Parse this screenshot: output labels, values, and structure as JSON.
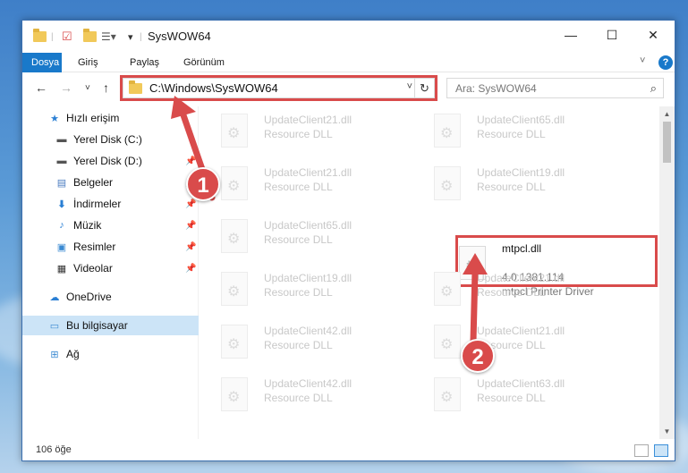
{
  "window": {
    "title": "SysWOW64",
    "controls": {
      "minimize": "—",
      "maximize": "☐",
      "close": "✕"
    }
  },
  "ribbon": {
    "tabs": [
      {
        "label": "Dosya",
        "active": true
      },
      {
        "label": "Giriş",
        "active": false
      },
      {
        "label": "Paylaş",
        "active": false
      },
      {
        "label": "Görünüm",
        "active": false
      }
    ],
    "help": "?"
  },
  "nav": {
    "back": "←",
    "forward": "→",
    "recent": "˅",
    "up": "↑",
    "address": "C:\\Windows\\SysWOW64",
    "search_placeholder": "Ara: SysWOW64"
  },
  "sidebar": {
    "items": [
      {
        "label": "Hızlı erişim",
        "icon": "star-icon",
        "pinned": false,
        "selected": false
      },
      {
        "label": "Yerel Disk (C:)",
        "icon": "drive-icon",
        "pinned": false,
        "selected": false
      },
      {
        "label": "Yerel Disk (D:)",
        "icon": "drive-icon",
        "pinned": true,
        "selected": false
      },
      {
        "label": "Belgeler",
        "icon": "documents-icon",
        "pinned": true,
        "selected": false
      },
      {
        "label": "İndirmeler",
        "icon": "downloads-icon",
        "pinned": true,
        "selected": false
      },
      {
        "label": "Müzik",
        "icon": "music-icon",
        "pinned": true,
        "selected": false
      },
      {
        "label": "Resimler",
        "icon": "pictures-icon",
        "pinned": true,
        "selected": false
      },
      {
        "label": "Videolar",
        "icon": "videos-icon",
        "pinned": true,
        "selected": false
      },
      {
        "label": "OneDrive",
        "icon": "cloud-icon",
        "pinned": false,
        "selected": false
      },
      {
        "label": "Bu bilgisayar",
        "icon": "computer-icon",
        "pinned": false,
        "selected": true
      },
      {
        "label": "Ağ",
        "icon": "network-icon",
        "pinned": false,
        "selected": false
      }
    ]
  },
  "files": [
    {
      "name": "UpdateClient21.dll",
      "desc": "Resource DLL"
    },
    {
      "name": "UpdateClient65.dll",
      "desc": "Resource DLL"
    },
    {
      "name": "UpdateClient21.dll",
      "desc": "Resource DLL"
    },
    {
      "name": "UpdateClient19.dll",
      "desc": "Resource DLL"
    },
    {
      "name": "UpdateClient65.dll",
      "desc": "Resource DLL"
    },
    {
      "name": "mtpcl.dll",
      "version": "4.0.1381.114",
      "desc": "mtpcl Printer Driver"
    },
    {
      "name": "UpdateClient19.dll",
      "desc": "Resource DLL"
    },
    {
      "name": "UpdateClient21.dll",
      "desc": "Resource DLL"
    },
    {
      "name": "UpdateClient42.dll",
      "desc": "Resource DLL"
    },
    {
      "name": "UpdateClient21.dll",
      "desc": "Resource DLL"
    },
    {
      "name": "UpdateClient42.dll",
      "desc": "Resource DLL"
    },
    {
      "name": "UpdateClient63.dll",
      "desc": "Resource DLL"
    }
  ],
  "status": {
    "count": "106 öğe"
  },
  "annotations": {
    "step1": "1",
    "step2": "2"
  },
  "colors": {
    "accent": "#1979ca",
    "highlight": "#d94b4b",
    "selected": "#cce4f7"
  }
}
